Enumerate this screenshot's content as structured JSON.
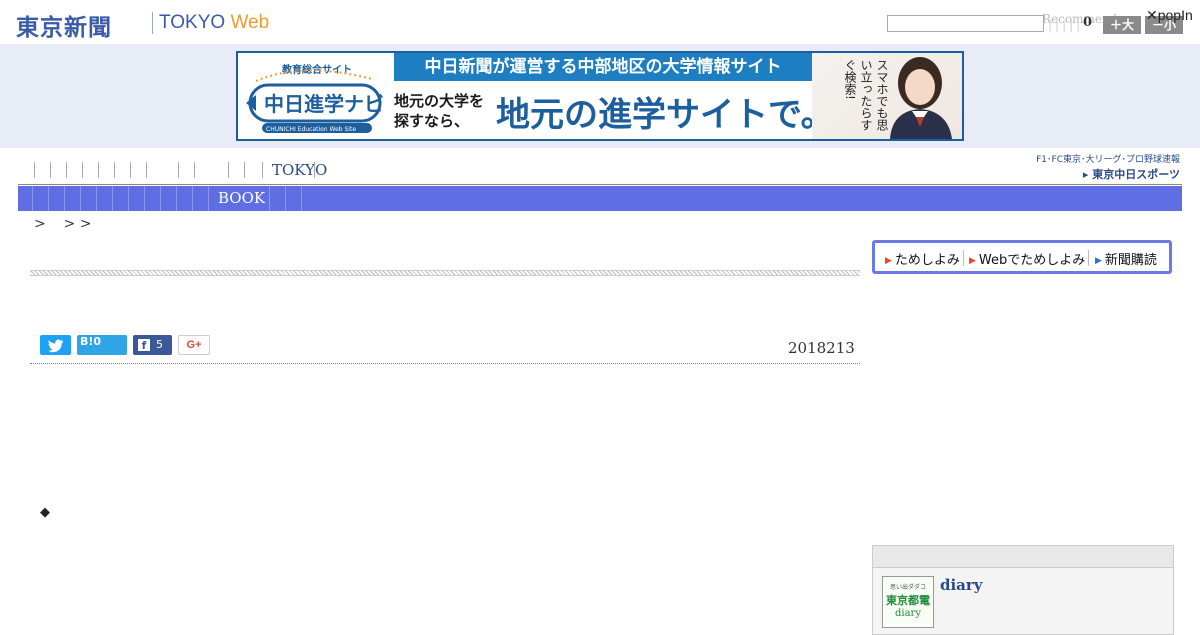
{
  "header": {
    "logo_jp": "東京新聞",
    "logo_tokyo": "TOKYO",
    "logo_web": "Web",
    "search_placeholder": "",
    "recommend_text": "Recommend",
    "count": "0",
    "font_large": "＋大",
    "font_small": "－小",
    "popin": "✕popIn"
  },
  "banner": {
    "logo_caption": "教育総合サイト",
    "logo_main": "中日進学ナビ",
    "logo_en": "CHUNICHI Education Web Site",
    "top_text": "中日新聞が運営する中部地区の大学情報サイト",
    "sub_text": "地元の大学を探すなら、",
    "main_text": "地元の進学サイトで。",
    "vertical_text": "スマホでも思い立ったらすぐ検索!"
  },
  "nav": {
    "primary_item": "TOKYO",
    "secondary_item": "BOOK",
    "sports_top": "F1･FC東京･大リーグ･プロ野球速報",
    "sports_bottom": "東京中日スポーツ"
  },
  "breadcrumb": ">    > >",
  "article": {
    "date": "2018213",
    "bullet": "◆"
  },
  "share": {
    "hatena": "B!0",
    "facebook_count": "5",
    "gplus": "G+"
  },
  "sidebar": {
    "tabs": [
      "ためしよみ",
      "Webでためしよみ",
      "新聞購読"
    ],
    "diary_label": "diary",
    "diary_thumb_top": "思い出ダダコ",
    "diary_thumb_mid": "東京都電",
    "diary_thumb_bottom": "diary"
  },
  "colors": {
    "brand_blue": "#3a5ba8",
    "web_orange": "#f29a2e",
    "nav_bar": "#5f6ee3",
    "twitter": "#1da1f2",
    "facebook": "#3b5998"
  }
}
